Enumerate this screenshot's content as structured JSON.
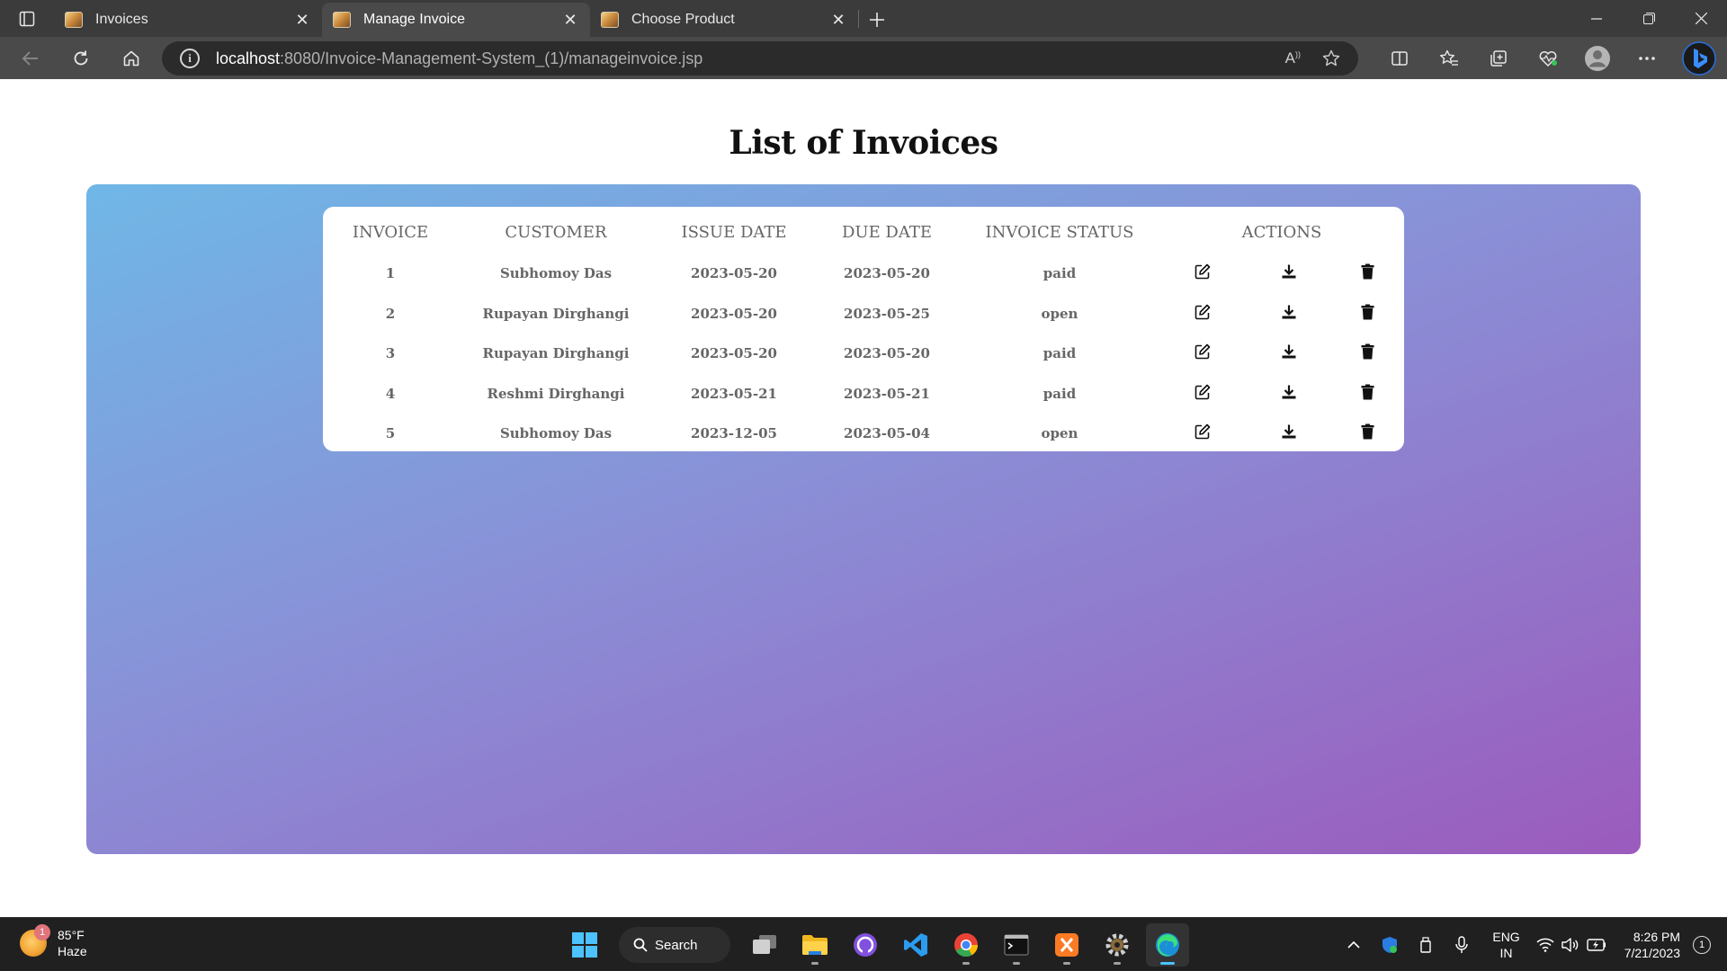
{
  "browser": {
    "tabs": [
      {
        "title": "Invoices",
        "active": false
      },
      {
        "title": "Manage Invoice",
        "active": true
      },
      {
        "title": "Choose Product",
        "active": false
      }
    ],
    "url": {
      "host": "localhost",
      "path": ":8080/Invoice-Management-System_(1)/manageinvoice.jsp"
    }
  },
  "page": {
    "title": "List of Invoices",
    "table": {
      "headers": {
        "invoice": "INVOICE",
        "customer": "CUSTOMER",
        "issue_date": "ISSUE DATE",
        "due_date": "DUE DATE",
        "status": "INVOICE STATUS",
        "actions": "ACTIONS"
      },
      "rows": [
        {
          "invoice": "1",
          "customer": "Subhomoy Das",
          "issue_date": "2023-05-20",
          "due_date": "2023-05-20",
          "status": "paid"
        },
        {
          "invoice": "2",
          "customer": "Rupayan Dirghangi",
          "issue_date": "2023-05-20",
          "due_date": "2023-05-25",
          "status": "open"
        },
        {
          "invoice": "3",
          "customer": "Rupayan Dirghangi",
          "issue_date": "2023-05-20",
          "due_date": "2023-05-20",
          "status": "paid"
        },
        {
          "invoice": "4",
          "customer": "Reshmi Dirghangi",
          "issue_date": "2023-05-21",
          "due_date": "2023-05-21",
          "status": "paid"
        },
        {
          "invoice": "5",
          "customer": "Subhomoy Das",
          "issue_date": "2023-12-05",
          "due_date": "2023-05-04",
          "status": "open"
        }
      ]
    }
  },
  "taskbar": {
    "weather": {
      "temp": "85°F",
      "condition": "Haze",
      "badge": "1"
    },
    "search_label": "Search",
    "lang": {
      "line1": "ENG",
      "line2": "IN"
    },
    "clock": {
      "time": "8:26 PM",
      "date": "7/21/2023"
    },
    "notification_count": "1"
  },
  "colors": {
    "panel_gradient_start": "#6fb7e6",
    "panel_gradient_end": "#9b5bbd",
    "browser_chrome": "#3b3b3b",
    "taskbar": "#202020"
  }
}
